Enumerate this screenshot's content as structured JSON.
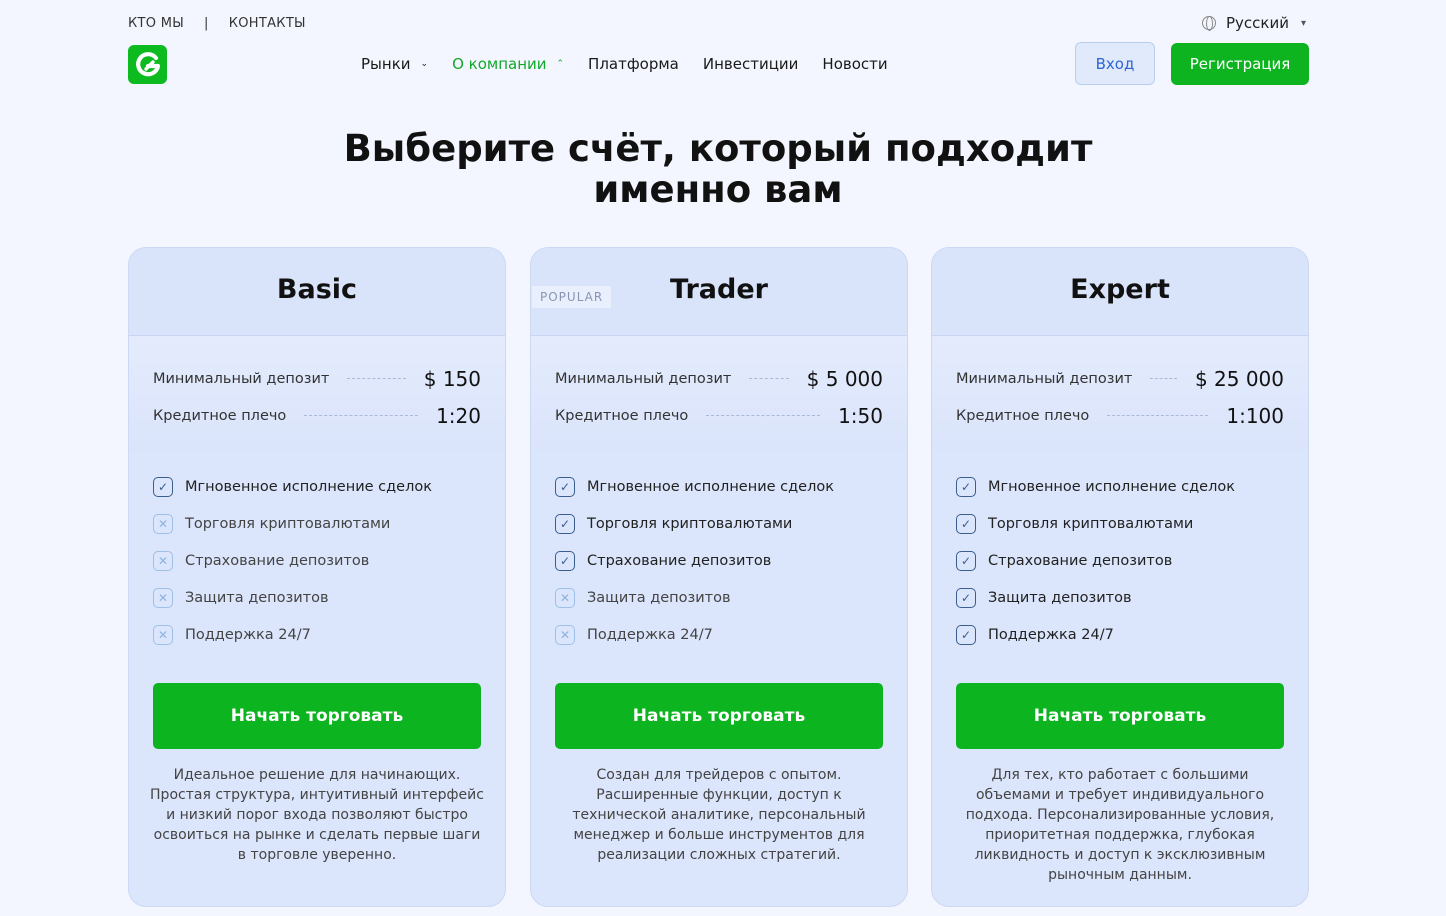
{
  "topbar": {
    "who": "КТО МЫ",
    "separator": "|",
    "contacts": "КОНТАКТЫ"
  },
  "language": {
    "label": "Русский"
  },
  "nav": {
    "items": [
      {
        "label": "Рынки",
        "has_dropdown": true,
        "expanded": false
      },
      {
        "label": "О компании",
        "has_dropdown": true,
        "expanded": true
      },
      {
        "label": "Платформа"
      },
      {
        "label": "Инвестиции"
      },
      {
        "label": "Новости"
      }
    ]
  },
  "auth": {
    "login": "Вход",
    "register": "Регистрация"
  },
  "headline": "Выберите счёт, который подходит именно вам",
  "colors": {
    "brand_green": "#0db41f",
    "active_nav": "#14a82c",
    "login_blue": "#2d64d6"
  },
  "plans": [
    {
      "name": "Basic",
      "badge": "",
      "deposit_label": "Минимальный депозит",
      "deposit_value": "$ 150",
      "leverage_label": "Кредитное плечо",
      "leverage_value": "1:20",
      "features": [
        {
          "label": "Мгновенное исполнение сделок",
          "included": true
        },
        {
          "label": "Торговля криптовалютами",
          "included": false
        },
        {
          "label": "Страхование депозитов",
          "included": false
        },
        {
          "label": "Защита депозитов",
          "included": false
        },
        {
          "label": "Поддержка 24/7",
          "included": false
        }
      ],
      "cta": "Начать торговать",
      "description": "Идеальное решение для начинающих. Простая структура, интуитивный интерфейс и низкий порог входа позволяют быстро освоиться на рынке и сделать первые шаги в торговле уверенно."
    },
    {
      "name": "Trader",
      "badge": "POPULAR",
      "deposit_label": "Минимальный депозит",
      "deposit_value": "$ 5 000",
      "leverage_label": "Кредитное плечо",
      "leverage_value": "1:50",
      "features": [
        {
          "label": "Мгновенное исполнение сделок",
          "included": true
        },
        {
          "label": "Торговля криптовалютами",
          "included": true
        },
        {
          "label": "Страхование депозитов",
          "included": true
        },
        {
          "label": "Защита депозитов",
          "included": false
        },
        {
          "label": "Поддержка 24/7",
          "included": false
        }
      ],
      "cta": "Начать торговать",
      "description": "Создан для трейдеров с опытом. Расширенные функции, доступ к технической аналитике, персональный менеджер и больше инструментов для реализации сложных стратегий."
    },
    {
      "name": "Expert",
      "badge": "",
      "deposit_label": "Минимальный депозит",
      "deposit_value": "$ 25 000",
      "leverage_label": "Кредитное плечо",
      "leverage_value": "1:100",
      "features": [
        {
          "label": "Мгновенное исполнение сделок",
          "included": true
        },
        {
          "label": "Торговля криптовалютами",
          "included": true
        },
        {
          "label": "Страхование депозитов",
          "included": true
        },
        {
          "label": "Защита депозитов",
          "included": true
        },
        {
          "label": "Поддержка 24/7",
          "included": true
        }
      ],
      "cta": "Начать торговать",
      "description": "Для тех, кто работает с большими объемами и требует индивидуального подхода. Персонализированные условия, приоритетная поддержка, глубокая ликвидность и доступ к эксклюзивным рыночным данным."
    }
  ]
}
